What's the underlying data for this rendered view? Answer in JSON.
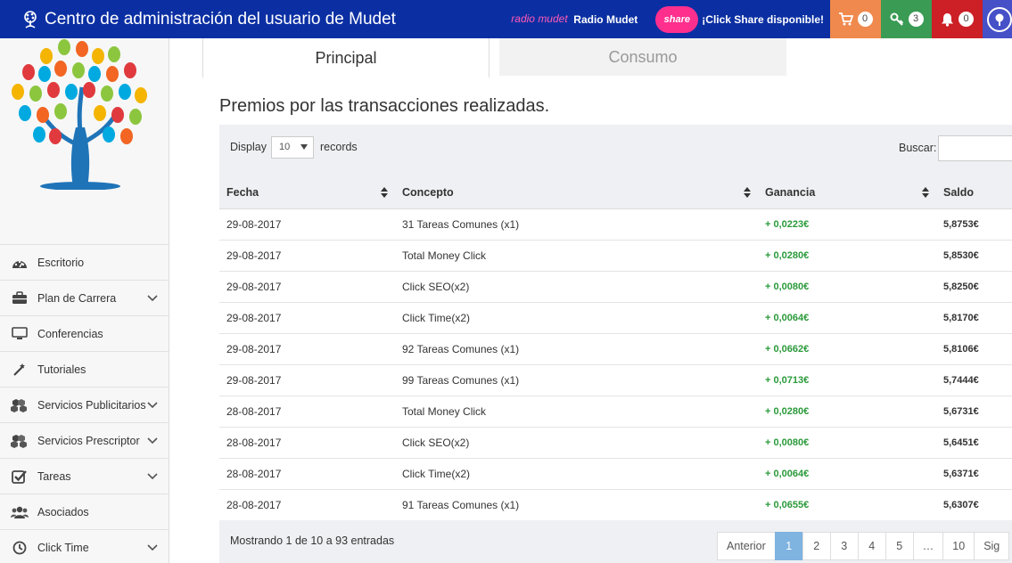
{
  "header": {
    "title": "Centro de administración del usuario de Mudet",
    "radio_logo": "radio mudet",
    "radio_label": "Radio Mudet",
    "share_logo": "share",
    "share_label": "¡Click Share disponible!",
    "cart_count": "0",
    "keys_count": "3",
    "notifications_count": "0"
  },
  "sidebar": {
    "items": [
      {
        "label": "Escritorio",
        "icon": "dashboard-icon",
        "expandable": false
      },
      {
        "label": "Plan de Carrera",
        "icon": "briefcase-icon",
        "expandable": true
      },
      {
        "label": "Conferencias",
        "icon": "monitor-icon",
        "expandable": false
      },
      {
        "label": "Tutoriales",
        "icon": "magic-wand-icon",
        "expandable": false
      },
      {
        "label": "Servicios Publicitarios",
        "icon": "cubes-icon",
        "expandable": true
      },
      {
        "label": "Servicios Prescriptor",
        "icon": "cubes-icon",
        "expandable": true
      },
      {
        "label": "Tareas",
        "icon": "checkbox-icon",
        "expandable": true
      },
      {
        "label": "Asociados",
        "icon": "users-icon",
        "expandable": false
      },
      {
        "label": "Click Time",
        "icon": "clock-icon",
        "expandable": true
      }
    ]
  },
  "tabs": [
    {
      "label": "Principal",
      "active": true
    },
    {
      "label": "Consumo",
      "active": false
    }
  ],
  "section_title": "Premios por las transacciones realizadas.",
  "controls": {
    "display_label": "Display",
    "display_value": "10",
    "records_label": "records",
    "search_label": "Buscar:",
    "search_value": ""
  },
  "table": {
    "columns": [
      "Fecha",
      "Concepto",
      "Ganancia",
      "Saldo"
    ],
    "rows": [
      {
        "fecha": "29-08-2017",
        "concepto": "31 Tareas Comunes (x1)",
        "ganancia": "+ 0,0223€",
        "saldo": "5,8753€"
      },
      {
        "fecha": "29-08-2017",
        "concepto": "Total Money Click",
        "ganancia": "+ 0,0280€",
        "saldo": "5,8530€"
      },
      {
        "fecha": "29-08-2017",
        "concepto": "Click SEO(x2)",
        "ganancia": "+ 0,0080€",
        "saldo": "5,8250€"
      },
      {
        "fecha": "29-08-2017",
        "concepto": "Click Time(x2)",
        "ganancia": "+ 0,0064€",
        "saldo": "5,8170€"
      },
      {
        "fecha": "29-08-2017",
        "concepto": "92 Tareas Comunes (x1)",
        "ganancia": "+ 0,0662€",
        "saldo": "5,8106€"
      },
      {
        "fecha": "29-08-2017",
        "concepto": "99 Tareas Comunes (x1)",
        "ganancia": "+ 0,0713€",
        "saldo": "5,7444€"
      },
      {
        "fecha": "28-08-2017",
        "concepto": "Total Money Click",
        "ganancia": "+ 0,0280€",
        "saldo": "5,6731€"
      },
      {
        "fecha": "28-08-2017",
        "concepto": "Click SEO(x2)",
        "ganancia": "+ 0,0080€",
        "saldo": "5,6451€"
      },
      {
        "fecha": "28-08-2017",
        "concepto": "Click Time(x2)",
        "ganancia": "+ 0,0064€",
        "saldo": "5,6371€"
      },
      {
        "fecha": "28-08-2017",
        "concepto": "91 Tareas Comunes (x1)",
        "ganancia": "+ 0,0655€",
        "saldo": "5,6307€"
      }
    ]
  },
  "footer": {
    "showing": "Mostrando 1 de 10 a 93 entradas",
    "pager": {
      "prev": "Anterior",
      "pages": [
        "1",
        "2",
        "3",
        "4",
        "5",
        "…",
        "10"
      ],
      "active": "1",
      "next": "Sig"
    }
  },
  "colors": {
    "topbar": "#0b2fa3",
    "cart": "#f0894d",
    "keys": "#3a9b54",
    "bell": "#cc1f26",
    "gain": "#2a9a3a",
    "pager_active": "#7fb3e0"
  }
}
